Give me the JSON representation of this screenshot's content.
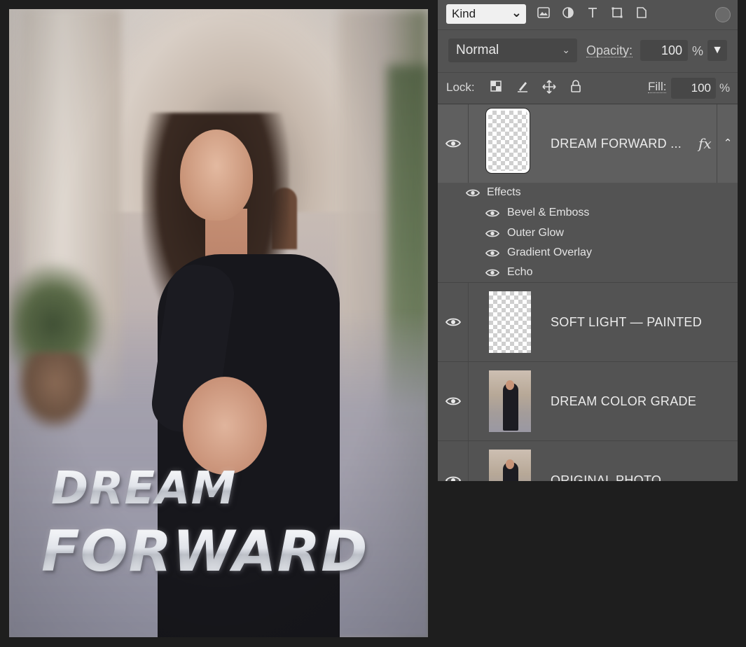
{
  "canvas": {
    "title_line_1": "DREAM",
    "title_line_2": "FORWARD"
  },
  "layers_panel": {
    "filter": {
      "kind_label": "Kind",
      "icons": [
        "pixel-filter-icon",
        "adjustment-filter-icon",
        "type-filter-icon",
        "shape-filter-icon",
        "smart-object-filter-icon",
        "filter-toggle-icon"
      ]
    },
    "blend": {
      "mode": "Normal",
      "opacity_label": "Opacity:",
      "opacity_value": "100",
      "percent": "%",
      "dropdown_glyph": "▼"
    },
    "lock": {
      "label": "Lock:",
      "icons": [
        "lock-transparent-pixels-icon",
        "lock-image-pixels-icon",
        "lock-position-icon",
        "lock-all-icon"
      ],
      "fill_label": "Fill:",
      "fill_value": "100",
      "percent": "%"
    },
    "layers": [
      {
        "name": "DREAM FORWARD ...",
        "fx": "fx",
        "selected": true,
        "visible": true,
        "effects_label": "Effects",
        "effects": [
          "Bevel & Emboss",
          "Outer Glow",
          "Gradient Overlay",
          "Echo"
        ]
      },
      {
        "name": "SOFT LIGHT — PAINTED",
        "visible": true
      },
      {
        "name": "DREAM COLOR GRADE",
        "visible": true
      },
      {
        "name": "ORIGINAL PHOTO",
        "visible": true
      }
    ]
  }
}
